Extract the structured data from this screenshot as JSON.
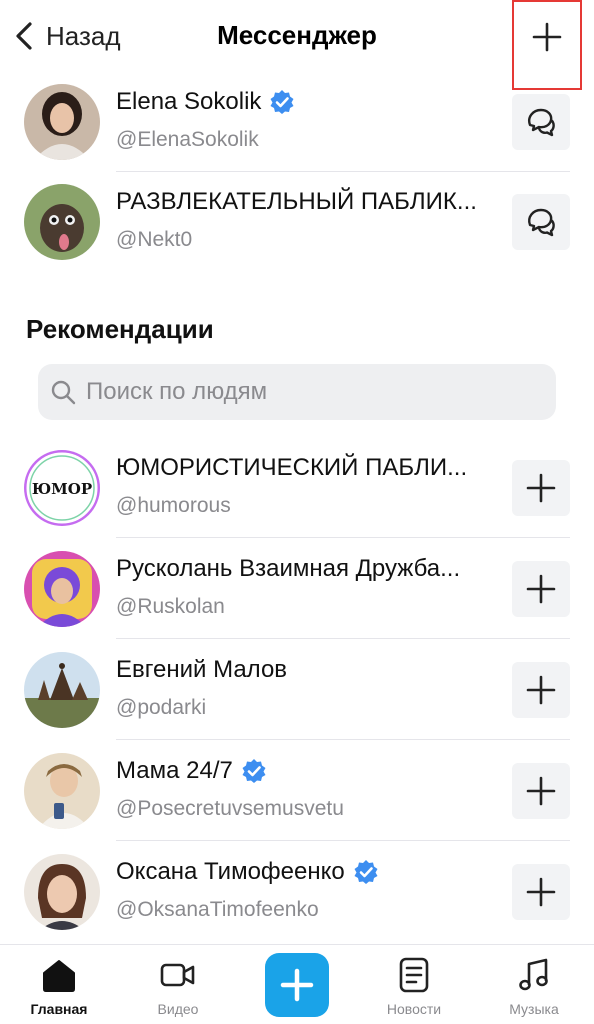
{
  "header": {
    "back_label": "Назад",
    "title": "Мессенджер",
    "add_icon": "plus-icon",
    "highlight_color": "#e53935"
  },
  "subscriptions": [
    {
      "name": "Elena Sokolik",
      "handle": "@ElenaSokolik",
      "verified": true,
      "action_icon": "chat-icon"
    },
    {
      "name": "РАЗВЛЕКАТЕЛЬНЫЙ ПАБЛИК...",
      "handle": "@Nekt0",
      "verified": false,
      "action_icon": "chat-icon"
    }
  ],
  "recommendations": {
    "title": "Рекомендации",
    "search_placeholder": "Поиск по людям",
    "items": [
      {
        "name": "ЮМОРИСТИЧЕСКИЙ ПАБЛИ...",
        "handle": "@humorous",
        "verified": false,
        "avatar_text": "ЮМОР",
        "action_icon": "plus-icon"
      },
      {
        "name": "Русколань Взаимная Дружба...",
        "handle": "@Ruskolan",
        "verified": false,
        "action_icon": "plus-icon"
      },
      {
        "name": "Евгений Малов",
        "handle": "@podarki",
        "verified": false,
        "action_icon": "plus-icon"
      },
      {
        "name": "Мама 24/7",
        "handle": "@Posecretuvsemusvetu",
        "verified": true,
        "action_icon": "plus-icon"
      },
      {
        "name": "Оксана Тимофеенко",
        "handle": "@OksanaTimofeenko",
        "verified": true,
        "action_icon": "plus-icon"
      }
    ]
  },
  "tabbar": {
    "home": "Главная",
    "video": "Видео",
    "news": "Новости",
    "music": "Музыка",
    "accent_color": "#1aa3e8"
  },
  "colors": {
    "verified": "#3d8ef0",
    "button_bg": "#f2f3f5",
    "secondary_text": "#8a8a8e"
  }
}
